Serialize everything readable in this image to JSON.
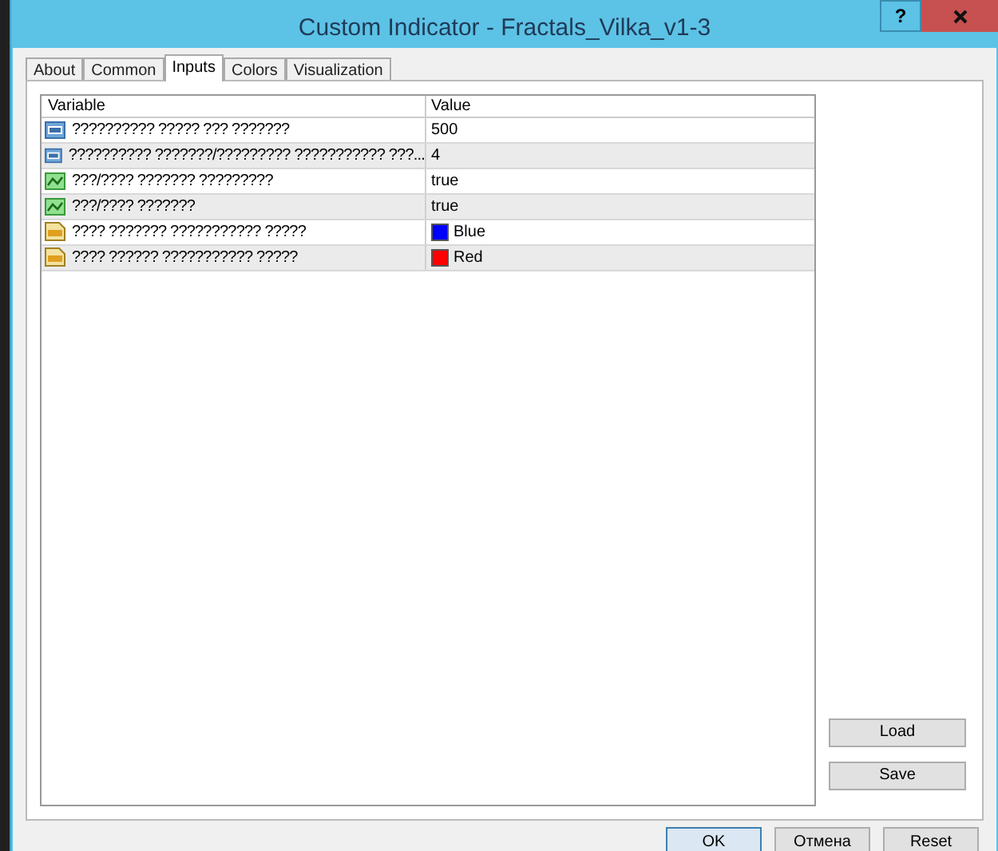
{
  "window": {
    "title": "Custom Indicator - Fractals_Vilka_v1-3",
    "help_button": "?"
  },
  "tabs": [
    {
      "label": "About",
      "selected": false
    },
    {
      "label": "Common",
      "selected": false
    },
    {
      "label": "Inputs",
      "selected": true
    },
    {
      "label": "Colors",
      "selected": false
    },
    {
      "label": "Visualization",
      "selected": false
    }
  ],
  "table": {
    "columns": [
      "Variable",
      "Value"
    ],
    "rows": [
      {
        "kind": "int",
        "variable": "?????????? ????? ??? ???????",
        "value": "500"
      },
      {
        "kind": "int",
        "variable": "?????????? ???????/????????? ??????????? ???...",
        "value": "4"
      },
      {
        "kind": "bool",
        "variable": "???/???? ??????? ?????????",
        "value": "true"
      },
      {
        "kind": "bool",
        "variable": "???/???? ???????",
        "value": "true"
      },
      {
        "kind": "color",
        "variable": "???? ??????? ??????????? ?????",
        "value": "Blue",
        "color": "#0000ff"
      },
      {
        "kind": "color",
        "variable": "???? ?????? ??????????? ?????",
        "value": "Red",
        "color": "#ff0000"
      }
    ]
  },
  "side_buttons": [
    "Load",
    "Save"
  ],
  "buttons": [
    "OK",
    "Отмена",
    "Reset"
  ]
}
